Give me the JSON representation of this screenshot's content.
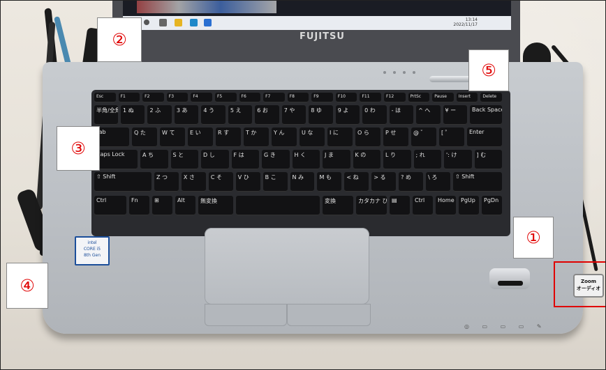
{
  "laptop": {
    "brand": "FUJITSU",
    "taskbar_time": "13:14",
    "taskbar_date": "2022/11/17",
    "zoom_sticker": "Zoom\nオーディオ",
    "intel_label": "intel\nCORE i5\n8th Gen"
  },
  "annotations": [
    {
      "id": "1",
      "label": "①"
    },
    {
      "id": "2",
      "label": "②"
    },
    {
      "id": "3",
      "label": "③"
    },
    {
      "id": "4",
      "label": "④"
    },
    {
      "id": "5",
      "label": "⑤"
    }
  ],
  "keyboard": {
    "row_fn": [
      "Esc",
      "F1",
      "F2",
      "F3",
      "F4",
      "F5",
      "F6",
      "F7",
      "F8",
      "F9",
      "F10",
      "F11",
      "F12",
      "PrtSc",
      "Pause",
      "Insert",
      "Delete"
    ],
    "row_num": [
      "半角/全角",
      "1 ぬ",
      "2 ふ",
      "3 あ",
      "4 う",
      "5 え",
      "6 お",
      "7 や",
      "8 ゆ",
      "9 よ",
      "0 わ",
      "- ほ",
      "^ へ",
      "¥ ー",
      "Back Space"
    ],
    "row_q": [
      "Tab",
      "Q た",
      "W て",
      "E い",
      "R す",
      "T か",
      "Y ん",
      "U な",
      "I に",
      "O ら",
      "P せ",
      "@ ゛",
      "[ ゜",
      "Enter"
    ],
    "row_a": [
      "Caps Lock",
      "A ち",
      "S と",
      "D し",
      "F は",
      "G き",
      "H く",
      "J ま",
      "K の",
      "L り",
      "; れ",
      "': け",
      "] む"
    ],
    "row_z": [
      "⇧ Shift",
      "Z つ",
      "X さ",
      "C そ",
      "V ひ",
      "B こ",
      "N み",
      "M も",
      "< ね",
      "> る",
      "? め",
      "\\ ろ",
      "⇧ Shift"
    ],
    "row_ctrl": [
      "Ctrl",
      "Fn",
      "⊞",
      "Alt",
      "無変換",
      "",
      "変換",
      "カタカナ ひらがな",
      "▤",
      "Ctrl",
      "Home",
      "PgUp",
      "PgDn"
    ]
  }
}
